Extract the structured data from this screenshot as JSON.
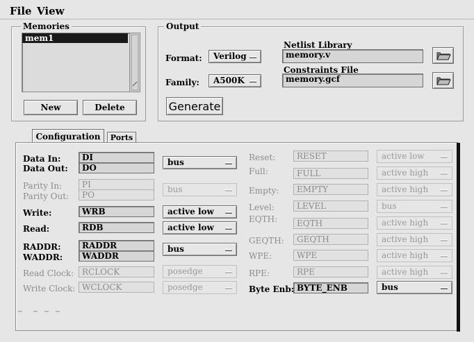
{
  "menu": {
    "file": "File",
    "view": "View"
  },
  "memories": {
    "title": "Memories",
    "items": [
      "mem1"
    ],
    "new_label": "New",
    "delete_label": "Delete"
  },
  "output": {
    "title": "Output",
    "format_label": "Format:",
    "format_value": "Verilog",
    "family_label": "Family:",
    "family_value": "A500K",
    "netlist_label": "Netlist Library",
    "netlist_value": "memory.v",
    "constraints_label": "Constraints File",
    "constraints_value": "memory.gcf",
    "generate_label": "Generate"
  },
  "tabs": {
    "configuration": "Configuration",
    "ports": "Ports"
  },
  "ports": {
    "data_in_label": "Data In:",
    "data_in_value": "DI",
    "data_out_label": "Data Out:",
    "data_out_value": "DO",
    "data_option": "bus",
    "parity_in_label": "Parity In:",
    "parity_in_value": "PI",
    "parity_out_label": "Parity Out:",
    "parity_out_value": "PO",
    "parity_option": "bus",
    "write_label": "Write:",
    "write_value": "WRB",
    "write_option": "active low",
    "read_label": "Read:",
    "read_value": "RDB",
    "read_option": "active low",
    "raddr_label": "RADDR:",
    "raddr_value": "RADDR",
    "waddr_label": "WADDR:",
    "waddr_value": "WADDR",
    "addr_option": "bus",
    "read_clock_label": "Read Clock:",
    "read_clock_value": "RCLOCK",
    "read_clock_option": "posedge",
    "write_clock_label": "Write Clock:",
    "write_clock_value": "WCLOCK",
    "write_clock_option": "posedge",
    "reset_label": "Reset:",
    "reset_value": "RESET",
    "reset_option": "active low",
    "full_label": "Full:",
    "full_value": "FULL",
    "full_option": "active high",
    "empty_label": "Empty:",
    "empty_value": "EMPTY",
    "empty_option": "active high",
    "level_label": "Level:",
    "level_value": "LEVEL",
    "level_option": "bus",
    "eqth_label": "EQTH:",
    "eqth_value": "EQTH",
    "eqth_option": "active high",
    "geqth_label": "GEQTH:",
    "geqth_value": "GEQTH",
    "geqth_option": "active high",
    "wpe_label": "WPE:",
    "wpe_value": "WPE",
    "wpe_option": "active high",
    "rpe_label": "RPE:",
    "rpe_value": "RPE",
    "rpe_option": "active high",
    "byte_enb_label": "Byte Enb:",
    "byte_enb_value": "BYTE_ENB",
    "byte_enb_option": "bus"
  }
}
